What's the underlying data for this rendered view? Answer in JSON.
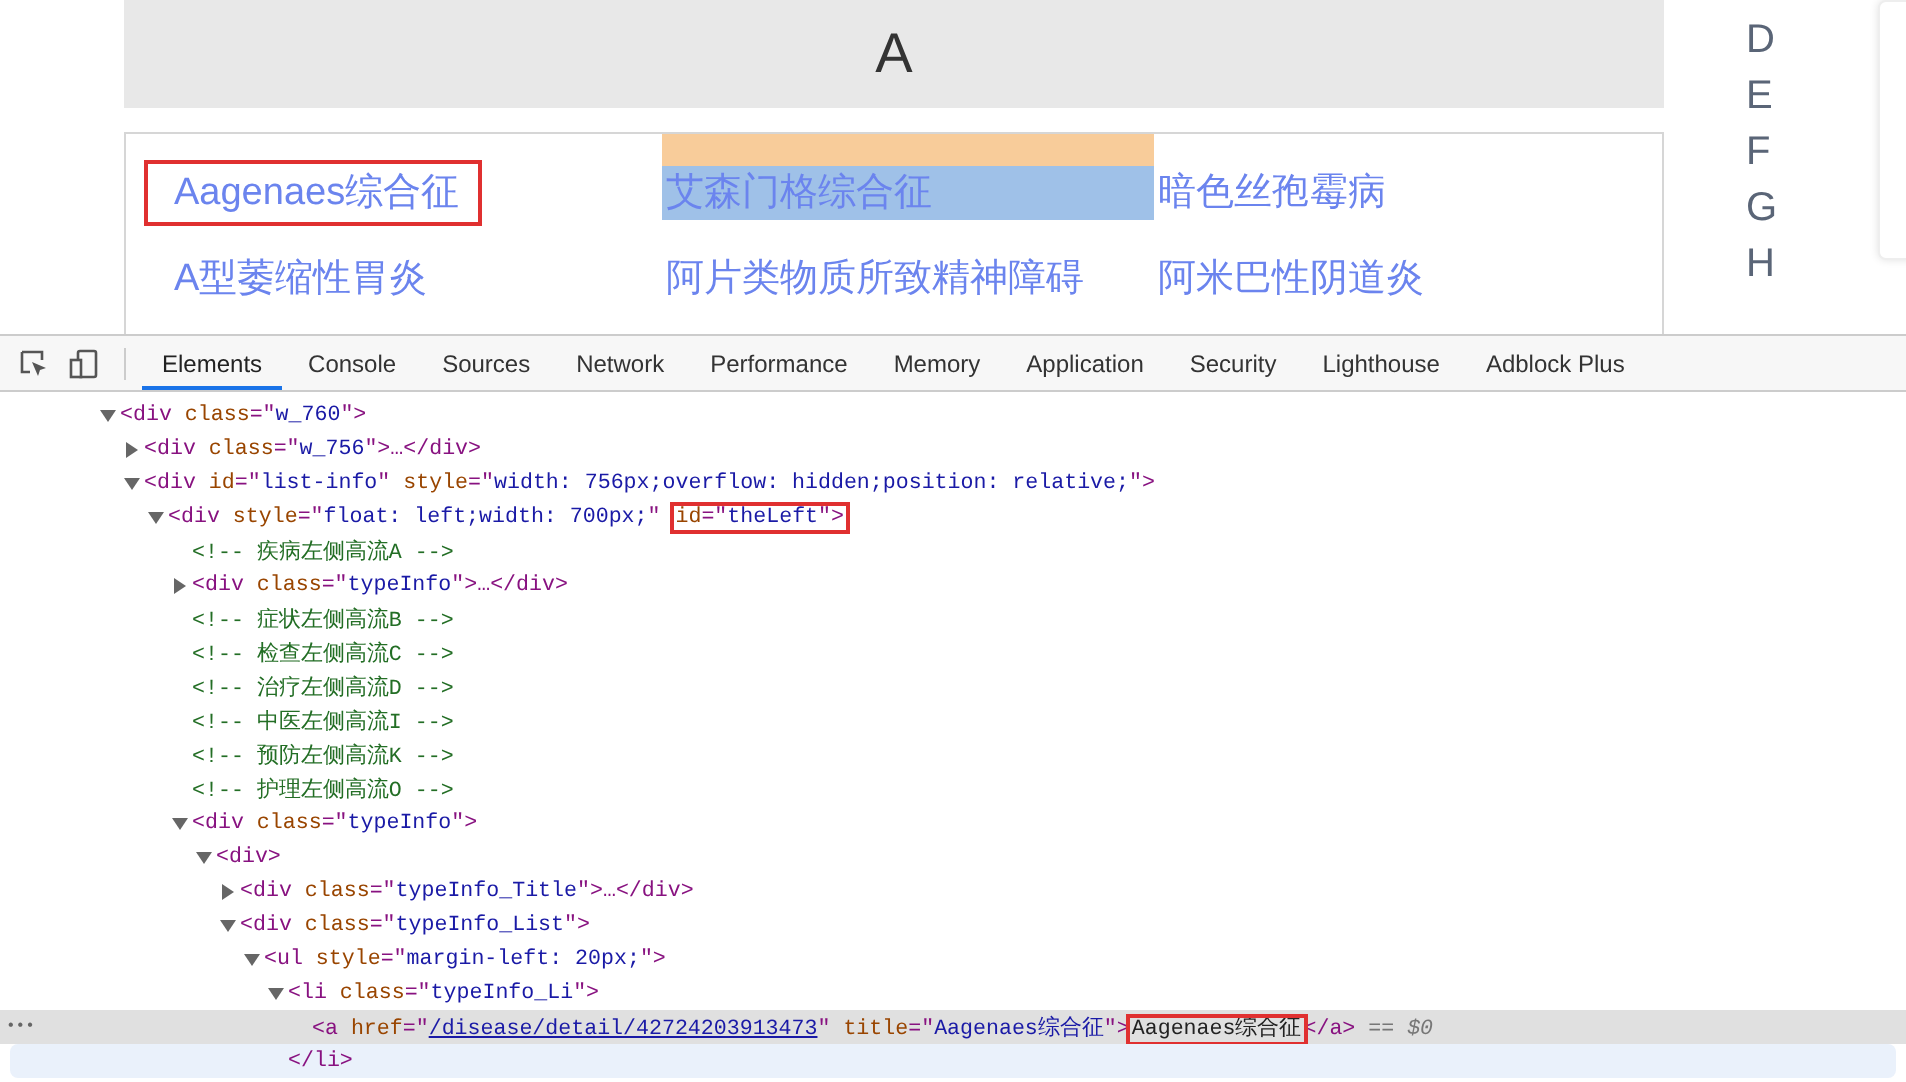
{
  "page": {
    "heading": "A",
    "letters": [
      "D",
      "E",
      "F",
      "G",
      "H"
    ],
    "links": [
      {
        "label": "Aagenaes综合征",
        "selected": false,
        "annotated": true
      },
      {
        "label": "艾森门格综合征",
        "selected": true,
        "annotated": false
      },
      {
        "label": "暗色丝孢霉病",
        "selected": false,
        "annotated": false
      },
      {
        "label": "A型萎缩性胃炎",
        "selected": false,
        "annotated": false
      },
      {
        "label": "阿片类物质所致精神障碍",
        "selected": false,
        "annotated": false
      },
      {
        "label": "阿米巴性阴道炎",
        "selected": false,
        "annotated": false
      }
    ]
  },
  "devtools": {
    "tabs": [
      {
        "label": "Elements",
        "selected": true
      },
      {
        "label": "Console",
        "selected": false
      },
      {
        "label": "Sources",
        "selected": false
      },
      {
        "label": "Network",
        "selected": false
      },
      {
        "label": "Performance",
        "selected": false
      },
      {
        "label": "Memory",
        "selected": false
      },
      {
        "label": "Application",
        "selected": false
      },
      {
        "label": "Security",
        "selected": false
      },
      {
        "label": "Lighthouse",
        "selected": false
      },
      {
        "label": "Adblock Plus",
        "selected": false
      }
    ],
    "lines": [
      {
        "kind": "expanded",
        "selected": false,
        "hovered": false,
        "segments": [
          {
            "kind": "tag",
            "text": "<div "
          },
          {
            "kind": "attr",
            "text": "class"
          },
          {
            "kind": "tag",
            "text": "=\""
          },
          {
            "kind": "value",
            "text": "w_760"
          },
          {
            "kind": "tag",
            "text": "\">"
          }
        ],
        "children": [
          {
            "kind": "collapsed",
            "selected": false,
            "hovered": false,
            "segments": [
              {
                "kind": "tag",
                "text": "<div "
              },
              {
                "kind": "attr",
                "text": "class"
              },
              {
                "kind": "tag",
                "text": "=\""
              },
              {
                "kind": "value",
                "text": "w_756"
              },
              {
                "kind": "tag",
                "text": "\">…</div>"
              }
            ]
          },
          {
            "kind": "expanded",
            "selected": false,
            "hovered": false,
            "segments": [
              {
                "kind": "tag",
                "text": "<div "
              },
              {
                "kind": "attr",
                "text": "id"
              },
              {
                "kind": "tag",
                "text": "=\""
              },
              {
                "kind": "value",
                "text": "list-info"
              },
              {
                "kind": "tag",
                "text": "\" "
              },
              {
                "kind": "attr",
                "text": "style"
              },
              {
                "kind": "tag",
                "text": "=\""
              },
              {
                "kind": "value",
                "text": "width: 756px;overflow: hidden;position: relative;"
              },
              {
                "kind": "tag",
                "text": "\">"
              }
            ],
            "children": [
              {
                "kind": "expanded",
                "selected": false,
                "hovered": false,
                "segments": [
                  {
                    "kind": "tag",
                    "text": "<div "
                  },
                  {
                    "kind": "attr",
                    "text": "style"
                  },
                  {
                    "kind": "tag",
                    "text": "=\""
                  },
                  {
                    "kind": "value",
                    "text": "float: left;width: 700px;"
                  },
                  {
                    "kind": "tag",
                    "text": "\" "
                  },
                  {
                    "kind": "boxed",
                    "children": [
                      {
                        "kind": "attr",
                        "text": "id"
                      },
                      {
                        "kind": "tag",
                        "text": "=\""
                      },
                      {
                        "kind": "value",
                        "text": "theLeft"
                      },
                      {
                        "kind": "tag",
                        "text": "\">"
                      }
                    ]
                  }
                ],
                "children": [
                  {
                    "kind": "leaf",
                    "selected": false,
                    "hovered": false,
                    "segments": [
                      {
                        "kind": "comment",
                        "text": "<!-- 疾病左侧高流A -->"
                      }
                    ]
                  },
                  {
                    "kind": "collapsed",
                    "selected": false,
                    "hovered": false,
                    "segments": [
                      {
                        "kind": "tag",
                        "text": "<div "
                      },
                      {
                        "kind": "attr",
                        "text": "class"
                      },
                      {
                        "kind": "tag",
                        "text": "=\""
                      },
                      {
                        "kind": "value",
                        "text": "typeInfo"
                      },
                      {
                        "kind": "tag",
                        "text": "\">…</div>"
                      }
                    ]
                  },
                  {
                    "kind": "leaf",
                    "selected": false,
                    "hovered": false,
                    "segments": [
                      {
                        "kind": "comment",
                        "text": "<!-- 症状左侧高流B -->"
                      }
                    ]
                  },
                  {
                    "kind": "leaf",
                    "selected": false,
                    "hovered": false,
                    "segments": [
                      {
                        "kind": "comment",
                        "text": "<!-- 检查左侧高流C -->"
                      }
                    ]
                  },
                  {
                    "kind": "leaf",
                    "selected": false,
                    "hovered": false,
                    "segments": [
                      {
                        "kind": "comment",
                        "text": "<!-- 治疗左侧高流D -->"
                      }
                    ]
                  },
                  {
                    "kind": "leaf",
                    "selected": false,
                    "hovered": false,
                    "segments": [
                      {
                        "kind": "comment",
                        "text": "<!-- 中医左侧高流I -->"
                      }
                    ]
                  },
                  {
                    "kind": "leaf",
                    "selected": false,
                    "hovered": false,
                    "segments": [
                      {
                        "kind": "comment",
                        "text": "<!-- 预防左侧高流K -->"
                      }
                    ]
                  },
                  {
                    "kind": "leaf",
                    "selected": false,
                    "hovered": false,
                    "segments": [
                      {
                        "kind": "comment",
                        "text": "<!-- 护理左侧高流O -->"
                      }
                    ]
                  },
                  {
                    "kind": "expanded",
                    "selected": false,
                    "hovered": false,
                    "segments": [
                      {
                        "kind": "tag",
                        "text": "<div "
                      },
                      {
                        "kind": "attr",
                        "text": "class"
                      },
                      {
                        "kind": "tag",
                        "text": "=\""
                      },
                      {
                        "kind": "value",
                        "text": "typeInfo"
                      },
                      {
                        "kind": "tag",
                        "text": "\">"
                      }
                    ],
                    "children": [
                      {
                        "kind": "expanded",
                        "selected": false,
                        "hovered": false,
                        "segments": [
                          {
                            "kind": "tag",
                            "text": "<div>"
                          }
                        ],
                        "children": [
                          {
                            "kind": "collapsed",
                            "selected": false,
                            "hovered": false,
                            "segments": [
                              {
                                "kind": "tag",
                                "text": "<div "
                              },
                              {
                                "kind": "attr",
                                "text": "class"
                              },
                              {
                                "kind": "tag",
                                "text": "=\""
                              },
                              {
                                "kind": "value",
                                "text": "typeInfo_Title"
                              },
                              {
                                "kind": "tag",
                                "text": "\">…</div>"
                              }
                            ]
                          },
                          {
                            "kind": "expanded",
                            "selected": false,
                            "hovered": false,
                            "segments": [
                              {
                                "kind": "tag",
                                "text": "<div "
                              },
                              {
                                "kind": "attr",
                                "text": "class"
                              },
                              {
                                "kind": "tag",
                                "text": "=\""
                              },
                              {
                                "kind": "value",
                                "text": "typeInfo_List"
                              },
                              {
                                "kind": "tag",
                                "text": "\">"
                              }
                            ],
                            "children": [
                              {
                                "kind": "expanded",
                                "selected": false,
                                "hovered": false,
                                "segments": [
                                  {
                                    "kind": "tag",
                                    "text": "<ul "
                                  },
                                  {
                                    "kind": "attr",
                                    "text": "style"
                                  },
                                  {
                                    "kind": "tag",
                                    "text": "=\""
                                  },
                                  {
                                    "kind": "value",
                                    "text": "margin-left: 20px;"
                                  },
                                  {
                                    "kind": "tag",
                                    "text": "\">"
                                  }
                                ],
                                "children": [
                                  {
                                    "kind": "expanded",
                                    "selected": false,
                                    "hovered": false,
                                    "segments": [
                                      {
                                        "kind": "tag",
                                        "text": "<li "
                                      },
                                      {
                                        "kind": "attr",
                                        "text": "class"
                                      },
                                      {
                                        "kind": "tag",
                                        "text": "=\""
                                      },
                                      {
                                        "kind": "value",
                                        "text": "typeInfo_Li"
                                      },
                                      {
                                        "kind": "tag",
                                        "text": "\">"
                                      }
                                    ],
                                    "children": [
                                      {
                                        "kind": "leaf",
                                        "selected": true,
                                        "hovered": false,
                                        "gutter": "•••",
                                        "segments": [
                                          {
                                            "kind": "tag",
                                            "text": "<a "
                                          },
                                          {
                                            "kind": "attr",
                                            "text": "href"
                                          },
                                          {
                                            "kind": "tag",
                                            "text": "=\""
                                          },
                                          {
                                            "kind": "link",
                                            "text": "/disease/detail/42724203913473"
                                          },
                                          {
                                            "kind": "tag",
                                            "text": "\" "
                                          },
                                          {
                                            "kind": "attr",
                                            "text": "title"
                                          },
                                          {
                                            "kind": "tag",
                                            "text": "=\""
                                          },
                                          {
                                            "kind": "value",
                                            "text": "Aagenaes综合征"
                                          },
                                          {
                                            "kind": "tag",
                                            "text": "\">"
                                          },
                                          {
                                            "kind": "boxed",
                                            "children": [
                                              {
                                                "kind": "text",
                                                "text": "Aagenaes综合征"
                                              }
                                            ]
                                          },
                                          {
                                            "kind": "tag",
                                            "text": "</a>"
                                          },
                                          {
                                            "kind": "note",
                                            "text": " == $0"
                                          }
                                        ]
                                      }
                                    ]
                                  },
                                  {
                                    "kind": "leaf",
                                    "selected": false,
                                    "hovered": true,
                                    "segments": [
                                      {
                                        "kind": "tag",
                                        "text": "</li>"
                                      }
                                    ]
                                  }
                                ]
                              }
                            ]
                          }
                        ]
                      }
                    ]
                  }
                ]
              }
            ]
          }
        ]
      }
    ]
  }
}
